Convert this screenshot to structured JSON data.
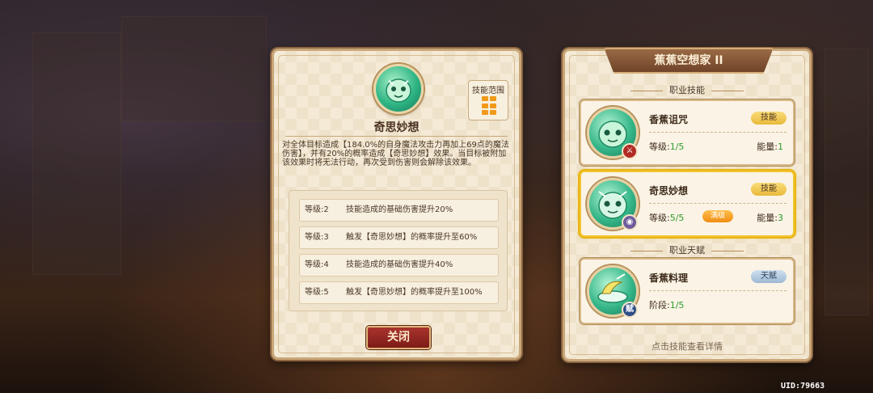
{
  "detail": {
    "skill_name": "奇思妙想",
    "range_label": "技能范围",
    "description": "对全体目标造成【184.0%的自身魔法攻击力再加上69点的魔法伤害】，并有20%的概率造成【奇思妙想】效果。当目标被附加该效果时将无法行动，再次受到伤害则会解除该效果。",
    "levels": [
      {
        "level": "等级:2",
        "text": "技能造成的基础伤害提升20%"
      },
      {
        "level": "等级:3",
        "text": "触发【奇思妙想】的概率提升至60%"
      },
      {
        "level": "等级:4",
        "text": "技能造成的基础伤害提升40%"
      },
      {
        "level": "等级:5",
        "text": "触发【奇思妙想】的概率提升至100%"
      }
    ],
    "close_label": "关闭"
  },
  "class_panel": {
    "title": "蕉蕉空想家 II",
    "skills_header": "职业技能",
    "talent_header": "职业天赋",
    "skills": [
      {
        "name": "香蕉诅咒",
        "tag": "技能",
        "level_label": "等级:",
        "level_value": "1/5",
        "energy_label": "能量:",
        "energy_value": "1",
        "badge": "⚔",
        "selected": false
      },
      {
        "name": "奇思妙想",
        "tag": "技能",
        "level_label": "等级:",
        "level_value": "5/5",
        "max_label": "满级",
        "energy_label": "能量:",
        "energy_value": "3",
        "badge": "◉",
        "selected": true
      }
    ],
    "talent": {
      "name": "香蕉料理",
      "tag": "天赋",
      "stage_label": "阶段:",
      "stage_value": "1/5",
      "badge": "赋"
    },
    "footer_hint": "点击技能查看详情"
  },
  "uid": "UID:79663",
  "colors": {
    "accent_gold": "#f3c531",
    "close_red": "#a8332c",
    "value_green": "#2f9c2b",
    "range_orange": "#f19a1a"
  }
}
